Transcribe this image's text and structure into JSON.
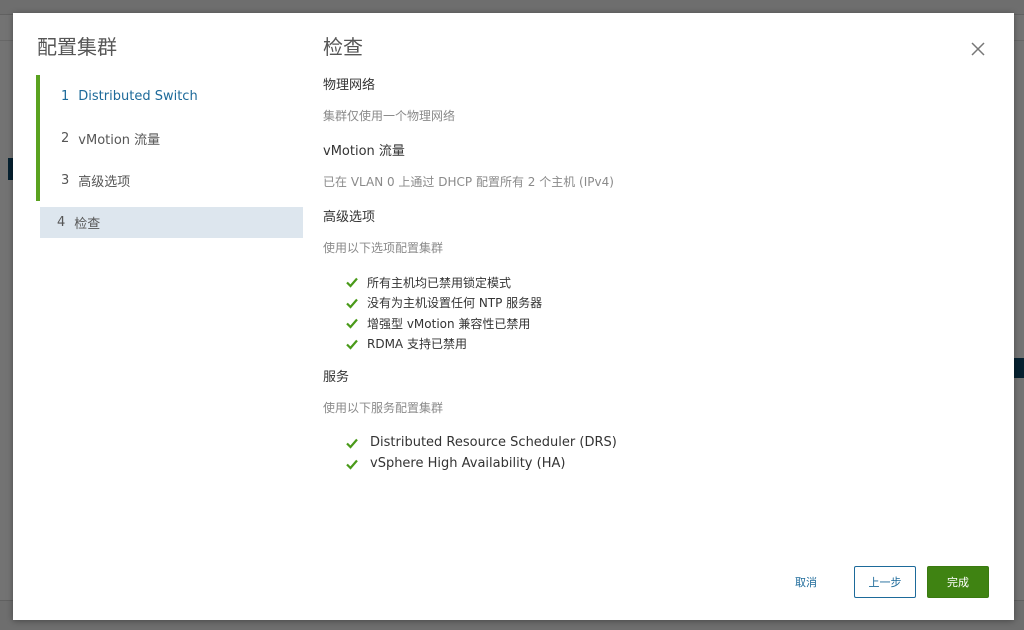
{
  "modal": {
    "title": "配置集群"
  },
  "steps": [
    {
      "num": "1",
      "label": "Distributed Switch"
    },
    {
      "num": "2",
      "label": "vMotion 流量"
    },
    {
      "num": "3",
      "label": "高级选项"
    },
    {
      "num": "4",
      "label": "检查"
    }
  ],
  "review": {
    "title": "检查",
    "physical_network": {
      "title": "物理网络",
      "desc": "集群仅使用一个物理网络"
    },
    "vmotion": {
      "title": "vMotion 流量",
      "desc": "已在 VLAN 0 上通过 DHCP 配置所有 2 个主机 (IPv4)"
    },
    "advanced": {
      "title": "高级选项",
      "desc": "使用以下选项配置集群",
      "items": [
        "所有主机均已禁用锁定模式",
        "没有为主机设置任何 NTP 服务器",
        "增强型 vMotion 兼容性已禁用",
        "RDMA 支持已禁用"
      ]
    },
    "services": {
      "title": "服务",
      "desc": "使用以下服务配置集群",
      "items": [
        "Distributed Resource Scheduler (DRS)",
        "vSphere High Availability (HA)"
      ]
    }
  },
  "footer": {
    "cancel": "取消",
    "back": "上一步",
    "finish": "完成"
  },
  "colors": {
    "accent_green": "#5aa220",
    "primary_button": "#3f8312",
    "link_blue": "#1d6a9a",
    "active_step_bg": "#dde6ee",
    "check_green": "#4a9a1a"
  },
  "icons": {
    "close": "close-icon",
    "check": "check-icon"
  }
}
